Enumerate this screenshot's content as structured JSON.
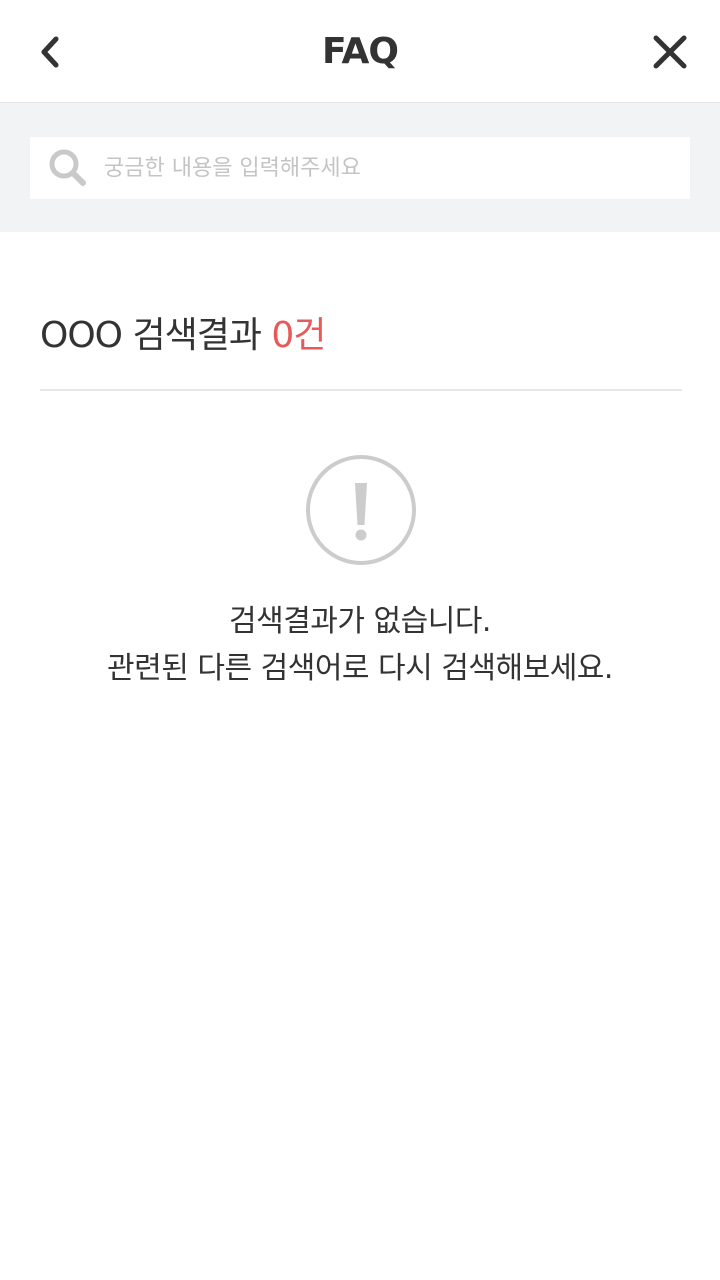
{
  "header": {
    "title": "FAQ",
    "back_icon": "chevron-left-icon",
    "close_icon": "close-icon"
  },
  "search": {
    "placeholder": "궁금한 내용을 입력해주세요",
    "value": "",
    "icon": "search-icon"
  },
  "results": {
    "query": "OOO",
    "label": "검색결과",
    "count_text": "0건",
    "accent_color": "#e85a5a"
  },
  "empty_state": {
    "icon": "exclamation-circle-icon",
    "message_line1": "검색결과가 없습니다.",
    "message_line2": "관련된 다른 검색어로 다시 검색해보세요."
  }
}
